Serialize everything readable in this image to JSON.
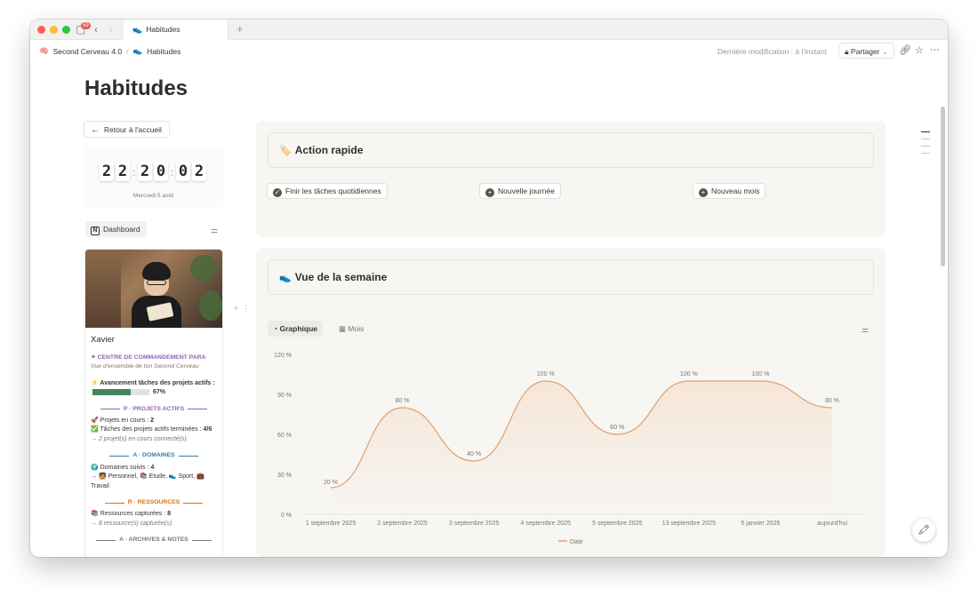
{
  "titlebar": {
    "badge": "59",
    "tab_label": "Habitudes",
    "tab_icon": "sneaker-icon",
    "newtab": "+"
  },
  "topbar": {
    "crumbs": [
      "Second Cerveau 4.0",
      "Habitudes"
    ],
    "last_modified": "Dernière modification : à l'instant",
    "share_label": "Partager"
  },
  "page": {
    "title": "Habitudes"
  },
  "sidebar": {
    "back_label": "Retour à l'accueil",
    "clock": {
      "h1": "2",
      "h2": "2",
      "m1": "2",
      "m2": "0",
      "s1": "0",
      "s2": "2",
      "date": "Mercredi 5 août"
    },
    "dashboard_label": "Dashboard",
    "profile": {
      "name": "Xavier",
      "command_center": "✦ CENTRE DE COMMANDEMENT PARA",
      "subtitle": "Vue d'ensemble de ton Second Cerveau",
      "progress_label": "⚡ Avancement tâches des projets actifs :",
      "progress_value": "67%",
      "progress_fraction": 0.67,
      "projects": {
        "header": "P · PROJETS ACTIFS",
        "in_progress_label": "🚀 Projets en cours :",
        "in_progress_value": "2",
        "tasks_label": "✅ Tâches des projets actifs terminées :",
        "tasks_value": "4/6",
        "connected": "→ 2 projet(s) en cours connecté(s)."
      },
      "domains": {
        "header": "A · DOMAINES",
        "followed_label": "🌍 Domaines suivis :",
        "followed_value": "4",
        "list": "→ 🧑‍🏫 Personnel, 📚 Etude, 👟 Sport, 💼 Travail"
      },
      "resources": {
        "header": "R · RESSOURCES",
        "captured_label": "📚 Ressources capturées :",
        "captured_value": "8",
        "note": "→ 8 ressource(s) capturée(s)."
      },
      "archives": {
        "header": "A · ARCHIVES & NOTES"
      }
    }
  },
  "quick_action": {
    "title": "Action rapide",
    "title_icon": "tag-icon",
    "buttons": [
      "Finir les tâches quotidiennes",
      "Nouvelle journée",
      "Nouveau mois"
    ]
  },
  "week_view": {
    "title": "Vue de la semaine",
    "title_icon": "sneaker-icon",
    "tabs": [
      "Graphique",
      "Mois"
    ]
  },
  "chart_data": {
    "type": "area",
    "categories": [
      "1 septembre 2025",
      "2 septembre 2025",
      "3 septembre 2025",
      "4 septembre 2025",
      "5 septembre 2025",
      "13 septembre 2025",
      "5 janvier 2026",
      "aujourd'hui"
    ],
    "series": [
      {
        "name": "Date",
        "values": [
          20,
          80,
          40,
          100,
          60,
          100,
          100,
          80
        ]
      }
    ],
    "data_labels": [
      "20 %",
      "80 %",
      "40 %",
      "100 %",
      "60 %",
      "100 %",
      "100 %",
      "80 %"
    ],
    "y_ticks": [
      "0 %",
      "30 %",
      "60 %",
      "90 %",
      "120 %"
    ],
    "ylim": [
      0,
      120
    ],
    "color": "#e0a070",
    "legend_position": "bottom",
    "grid": "horizontal"
  }
}
